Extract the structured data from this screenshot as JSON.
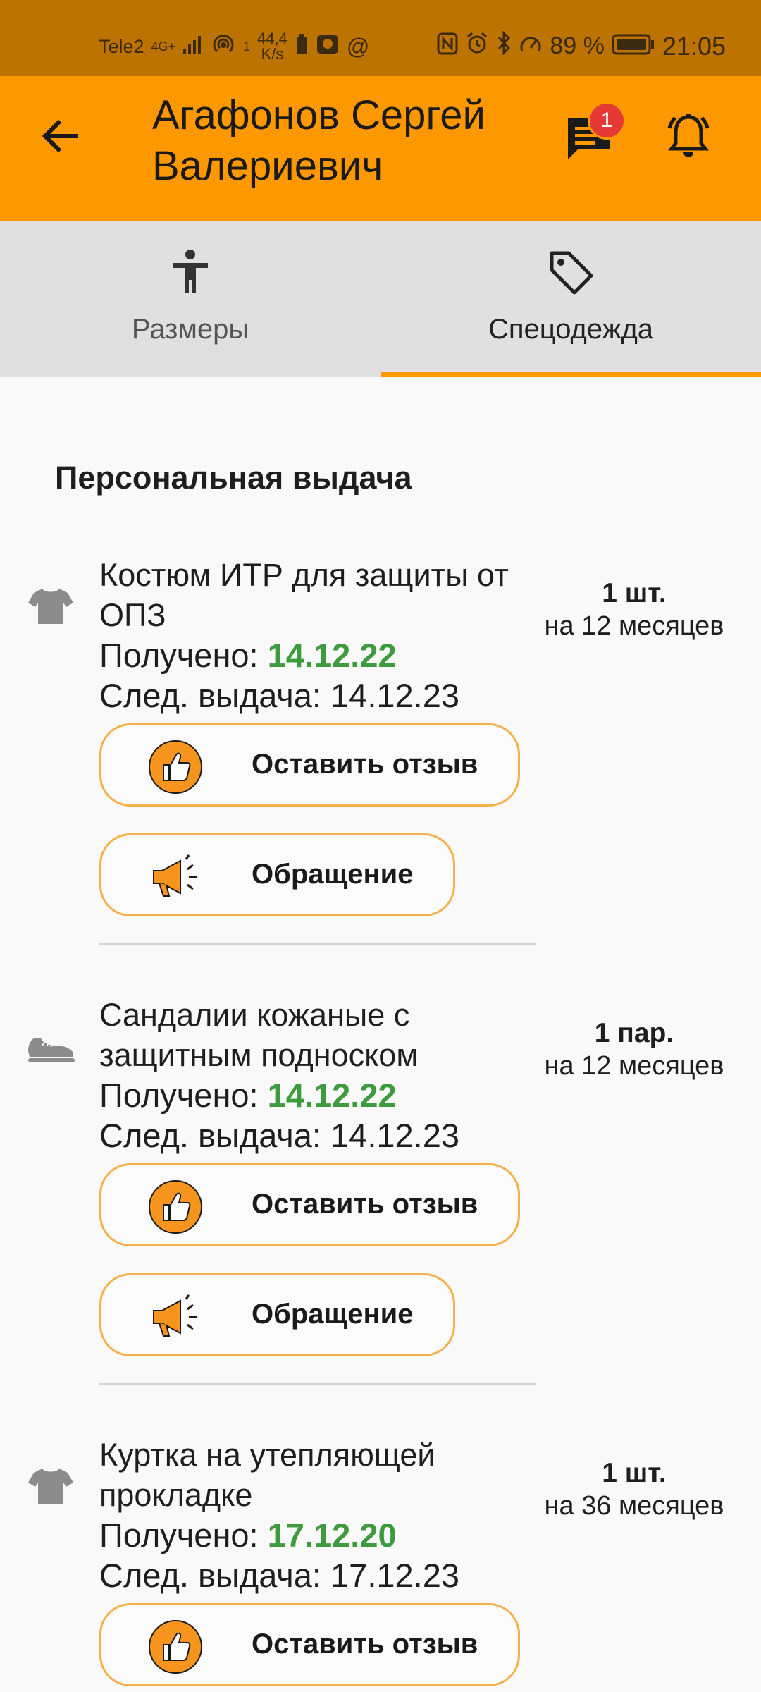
{
  "status_bar": {
    "carrier": "Tele2",
    "network": "4G+",
    "hotspot_count": "1",
    "speed_value": "44,4",
    "speed_unit": "K/s",
    "battery_percent": "89 %",
    "time": "21:05"
  },
  "header": {
    "title": "Агафонов Сергей Валериевич",
    "back_icon": "arrow-left-icon",
    "messages_icon": "chat-icon",
    "messages_badge": "1",
    "alarm_icon": "bell-icon"
  },
  "tabs": [
    {
      "label": "Размеры",
      "icon": "accessibility-icon",
      "active": false
    },
    {
      "label": "Спецодежда",
      "icon": "tag-icon",
      "active": true
    }
  ],
  "section_title": "Персональная выдача",
  "labels": {
    "received": "Получено:",
    "next_issue": "След. выдача:",
    "review_button": "Оставить отзыв",
    "appeal_button": "Обращение"
  },
  "items": [
    {
      "name": "Костюм ИТР для защиты от ОПЗ",
      "icon": "tshirt-icon",
      "received": "14.12.22",
      "next": "14.12.23",
      "qty": "1 шт.",
      "period": "на 12 месяцев"
    },
    {
      "name": "Сандалии кожаные с защитным подноском",
      "icon": "sneaker-icon",
      "received": "14.12.22",
      "next": "14.12.23",
      "qty": "1 пар.",
      "period": "на 12 месяцев"
    },
    {
      "name": "Куртка на утепляющей прокладке",
      "icon": "tshirt-icon",
      "received": "17.12.20",
      "next": "17.12.23",
      "qty": "1 шт.",
      "period": "на 36 месяцев"
    }
  ],
  "colors": {
    "status_bar": "#bd7302",
    "app_bar": "#fe9800",
    "tab_background": "#e0e0e0",
    "accent": "#fe9800",
    "received_date": "#3d9a3d",
    "badge": "#e53935"
  }
}
